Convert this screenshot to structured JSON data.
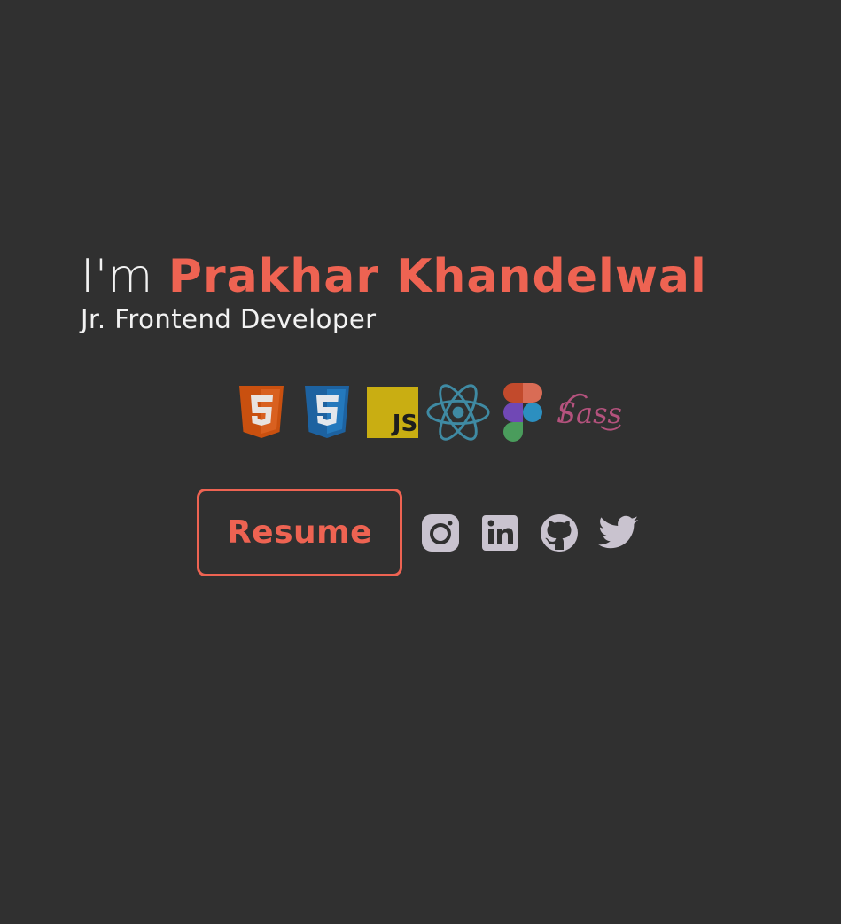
{
  "hero": {
    "greeting": "I'm",
    "name": "Prakhar Khandelwal",
    "role": "Jr. Frontend Developer"
  },
  "tech_stack": [
    {
      "icon": "html5-icon",
      "label": "HTML5"
    },
    {
      "icon": "css3-icon",
      "label": "CSS3"
    },
    {
      "icon": "javascript-icon",
      "label": "JS"
    },
    {
      "icon": "react-icon",
      "label": "React"
    },
    {
      "icon": "figma-icon",
      "label": "Figma"
    },
    {
      "icon": "sass-icon",
      "label": "Sass"
    }
  ],
  "actions": {
    "resume_label": "Resume"
  },
  "socials": [
    {
      "icon": "instagram-icon"
    },
    {
      "icon": "linkedin-icon"
    },
    {
      "icon": "github-icon"
    },
    {
      "icon": "twitter-icon"
    }
  ],
  "colors": {
    "background": "#303030",
    "accent": "#ee6352",
    "text": "#f2f2f2",
    "social_icon": "#c9c3cf"
  }
}
